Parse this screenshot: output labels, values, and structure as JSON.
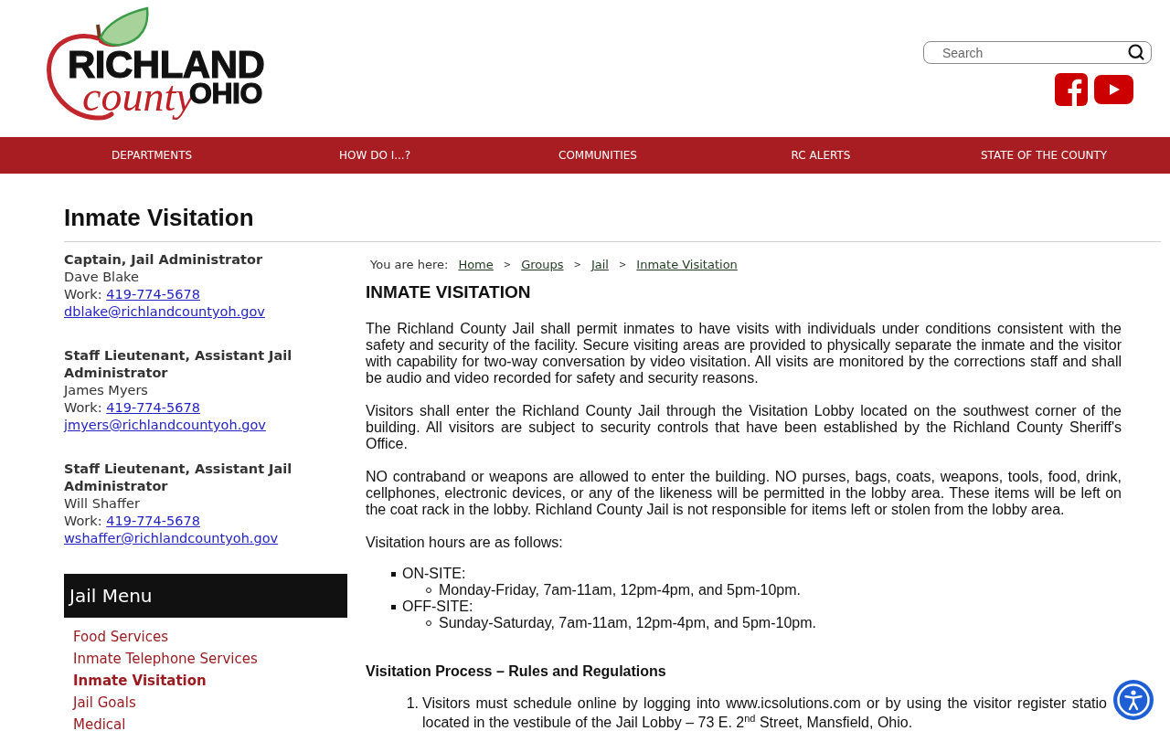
{
  "header": {
    "logo": {
      "line1": "RICHLAND",
      "line2": "county",
      "line3": "OHIO"
    },
    "search": {
      "placeholder": "Search"
    }
  },
  "nav": [
    {
      "label": "DEPARTMENTS"
    },
    {
      "label": "HOW DO I...?"
    },
    {
      "label": "COMMUNITIES"
    },
    {
      "label": "RC ALERTS"
    },
    {
      "label": "STATE OF THE COUNTY"
    }
  ],
  "page_title": "Inmate Visitation",
  "contacts": [
    {
      "title": "Captain, Jail Administrator",
      "name": "Dave Blake",
      "phone_label": "Work:",
      "phone": "419-774-5678",
      "email": "dblake@richlandcountyoh.gov"
    },
    {
      "title": "Staff Lieutenant, Assistant Jail Administrator",
      "name": "James Myers",
      "phone_label": "Work:",
      "phone": "419-774-5678",
      "email": "jmyers@richlandcountyoh.gov"
    },
    {
      "title": "Staff Lieutenant, Assistant Jail Administrator",
      "name": "Will Shaffer",
      "phone_label": "Work:",
      "phone": "419-774-5678",
      "email": "wshaffer@richlandcountyoh.gov"
    }
  ],
  "jail_menu": {
    "title": "Jail Menu",
    "items": [
      {
        "label": "Food Services",
        "selected": false
      },
      {
        "label": "Inmate Telephone Services",
        "selected": false
      },
      {
        "label": "Inmate Visitation",
        "selected": true
      },
      {
        "label": "Jail Goals",
        "selected": false
      },
      {
        "label": "Medical",
        "selected": false
      }
    ]
  },
  "breadcrumb": {
    "label": "You are here:",
    "links": [
      {
        "label": "Home"
      },
      {
        "label": "Groups"
      },
      {
        "label": "Jail"
      },
      {
        "label": "Inmate Visitation"
      }
    ],
    "separators": [
      ">",
      ">",
      ">"
    ]
  },
  "article": {
    "heading": "INMATE VISITATION",
    "paragraphs": [
      "The Richland County Jail shall permit inmates to have visits with individuals under conditions consistent with the safety and security of the facility. Secure visiting areas are provided to physically separate the inmate and the visitor with capability for two-way conversation by video visitation. All visits are monitored by the corrections staff and shall be audio and video recorded for safety and security reasons.",
      "Visitors shall enter the Richland County Jail through the Visitation Lobby located on the southwest corner of the building. All visitors are subject to security controls that have been established by the Richland County Sheriff's Office.",
      "NO contraband or weapons are allowed to enter the building. NO purses, bags, coats, weapons, tools, food, drink, cellphones, electronic devices, or any of the likeness will be permitted in the lobby area. These items will be left on the coat rack in the lobby. Richland County Jail is not responsible for items left or stolen from the lobby area.",
      "Visitation hours are as follows:"
    ],
    "hours": [
      {
        "label": "ON-SITE:",
        "details": [
          "Monday-Friday, 7am-11am, 12pm-4pm, and 5pm-10pm."
        ]
      },
      {
        "label": "OFF-SITE:",
        "details": [
          "Sunday-Saturday, 7am-11am, 12pm-4pm, and 5pm-10pm."
        ]
      }
    ],
    "section_heading": "Visitation Process – Rules and Regulations",
    "rules": [
      {
        "number": "1.",
        "text": "Visitors must schedule online by logging into www.icsolutions.com or by using the visitor register statio located in the vestibule of the Jail Lobby – 73 E. 2$^{nd}$ Street, Mansfield, Ohio."
      }
    ]
  }
}
